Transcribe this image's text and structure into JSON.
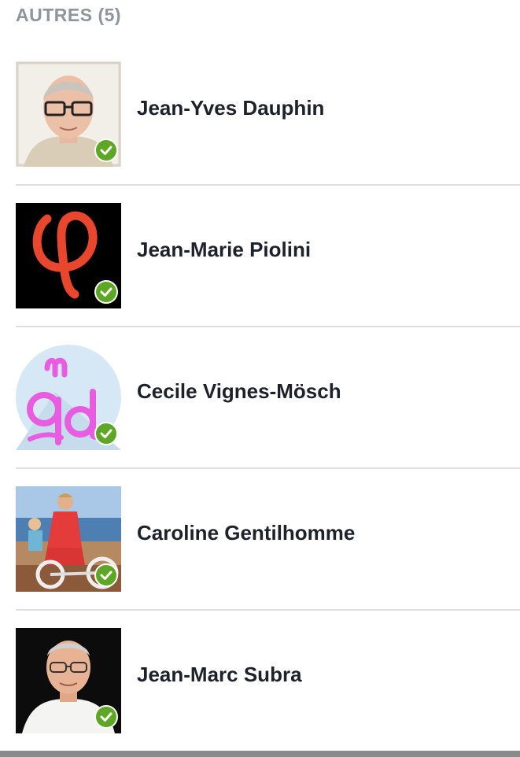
{
  "section": {
    "title": "AUTRES (5)"
  },
  "contacts": [
    {
      "name": "Jean-Yves Dauphin",
      "avatar_icon": "profile-photo",
      "status": "verified-check"
    },
    {
      "name": "Jean-Marie Piolini",
      "avatar_icon": "phi-logo",
      "status": "verified-check"
    },
    {
      "name": "Cecile Vignes-Mösch",
      "avatar_icon": "handwritten-logo",
      "status": "verified-check"
    },
    {
      "name": "Caroline Gentilhomme",
      "avatar_icon": "profile-photo",
      "status": "verified-check"
    },
    {
      "name": "Jean-Marc Subra",
      "avatar_icon": "profile-photo",
      "status": "verified-check"
    }
  ],
  "colors": {
    "header_text": "#90949c",
    "name_text": "#1d2129",
    "divider": "#dddfe2",
    "badge_green": "#5ea625"
  }
}
